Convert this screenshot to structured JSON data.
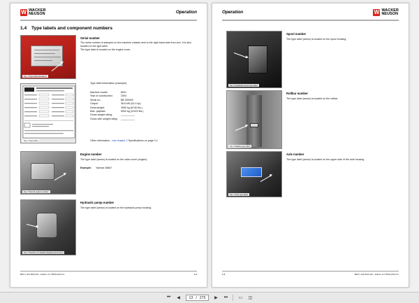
{
  "brand": {
    "logo_mark": "W",
    "logo_line1": "WACKER",
    "logo_line2": "NEUSON",
    "color": "#d8261c"
  },
  "left_page": {
    "header": "Operation",
    "section": {
      "number": "1.4",
      "title": "Type labels and component numbers"
    },
    "serial": {
      "title": "Serial number",
      "text": "The serial number is stamped on the machine chassis next to the right-hand side from tom. It is also located on the type label.",
      "text2": "The type label is located on the engine cover."
    },
    "fig1_caption": "Fig. 1    Type label (location)",
    "fig2_caption": "Fig. 2    Type label",
    "type_label_info": "Type label information (example):",
    "specs": [
      {
        "k": "Machine model:",
        "v": "8001"
      },
      {
        "k": "Year of construction:",
        "v": "2004"
      },
      {
        "k": "Serial no.:",
        "v": "BB 300000"
      },
      {
        "k": "Output:",
        "v": "38.6 kW (51.0 hp)"
      },
      {
        "k": "Dead weight:",
        "v": "3060 kg (6746 lbs.)"
      },
      {
        "k": "Max. payload:",
        "v": "5000 kg (11023 lbs.)"
      },
      {
        "k": "Gross weight rating:",
        "v": "__________"
      },
      {
        "k": "Gross axle weight rating:",
        "v": "__________"
      }
    ],
    "other_info_prefix": "Other information – ",
    "other_info_link": "see chapter 2",
    "other_info_suffix": " Specifications on page 2-1",
    "engine": {
      "title": "Engine number",
      "text": "The type label (arrow) is located on the valve cover (engine).",
      "example_label": "Example:",
      "example_value": "Yanmar 46667"
    },
    "fig3_caption": "Fig. 3    Stencil engine number",
    "pump": {
      "title": "Hydraulic pump number",
      "text": "The type label (arrow) is located on the hydraulic pump housing."
    },
    "fig4_caption": "Fig. 4    Number of variable displacement pump",
    "footer_left": "BETU 1HS 8001 EN – Edition 3.0 *8001s1514.fm",
    "footer_right": "1-4"
  },
  "right_page": {
    "header": "Operation",
    "spool": {
      "title": "Spool number",
      "text": "The type label (arrow) is located on the spool housing."
    },
    "fig5_caption": "Fig. 5    Hydraulic spool type label",
    "rollbar": {
      "title": "Rollbar number",
      "text": "The type label (arrow) is located on the rollbar."
    },
    "fig6_caption": "Fig. 6    Rollbar type label",
    "axle": {
      "title": "Axle number",
      "text": "The type label (arrow) is located on the upper side of the axle housing."
    },
    "fig7_caption": "Fig. 7    Axle type label",
    "footer_left": "1-5",
    "footer_right": "BETU 1HS 8001 EN – Edition 3.0 *8001s1514.fm"
  },
  "toolbar": {
    "first_icon": "first-page-icon",
    "prev_icon": "prev-page-icon",
    "current_page": "13",
    "separator": "/",
    "total_pages": "275",
    "next_icon": "next-page-icon",
    "last_icon": "last-page-icon"
  }
}
